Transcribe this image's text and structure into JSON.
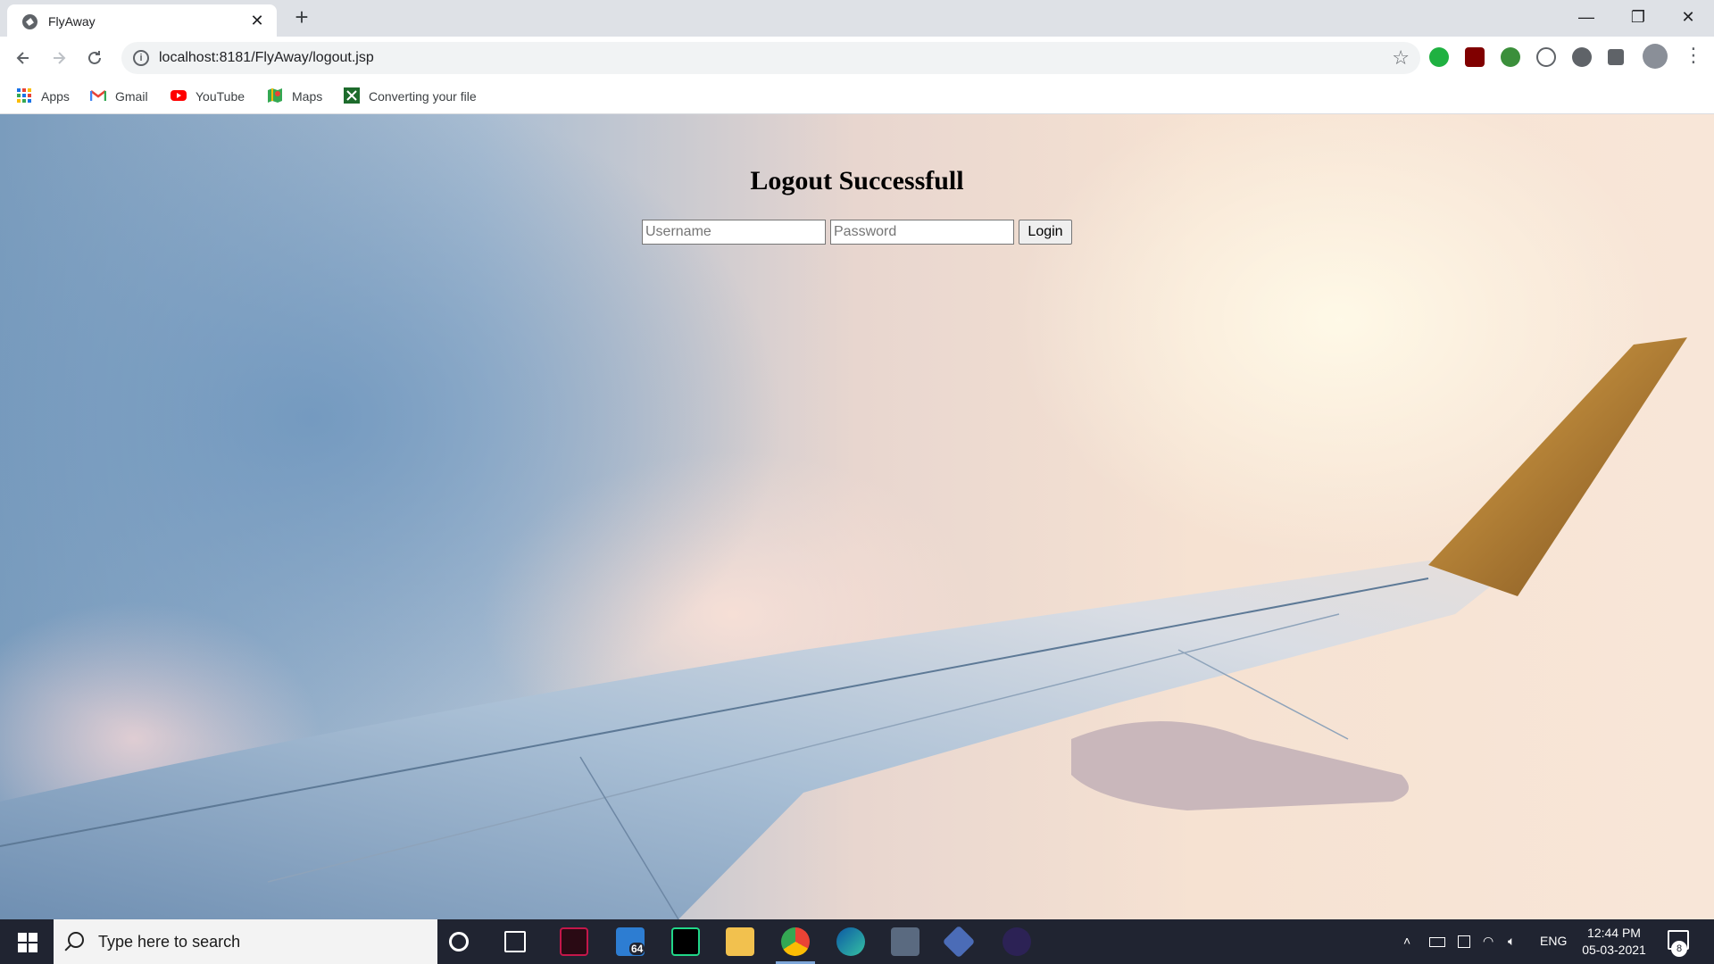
{
  "browser": {
    "tab_title": "FlyAway",
    "tab_close": "✕",
    "new_tab": "+",
    "url": "localhost:8181/FlyAway/logout.jsp",
    "window_controls": [
      "—",
      "❐",
      "✕"
    ]
  },
  "bookmarks": [
    {
      "label": "Apps",
      "icon": "apps-grid-icon"
    },
    {
      "label": "Gmail",
      "icon": "gmail-icon"
    },
    {
      "label": "YouTube",
      "icon": "youtube-icon"
    },
    {
      "label": "Maps",
      "icon": "maps-icon"
    },
    {
      "label": "Converting your file",
      "icon": "converter-icon"
    }
  ],
  "page": {
    "heading": "Logout Successfull",
    "username_placeholder": "Username",
    "password_placeholder": "Password",
    "login_label": "Login"
  },
  "taskbar": {
    "search_placeholder": "Type here to search",
    "mail_badge": "64",
    "language": "ENG",
    "time": "12:44 PM",
    "date": "05-03-2021",
    "notification_count": "8"
  },
  "colors": {
    "chrome_bg": "#dee1e6",
    "taskbar_bg": "#202431",
    "chrome_active": "#7ea6d8"
  }
}
